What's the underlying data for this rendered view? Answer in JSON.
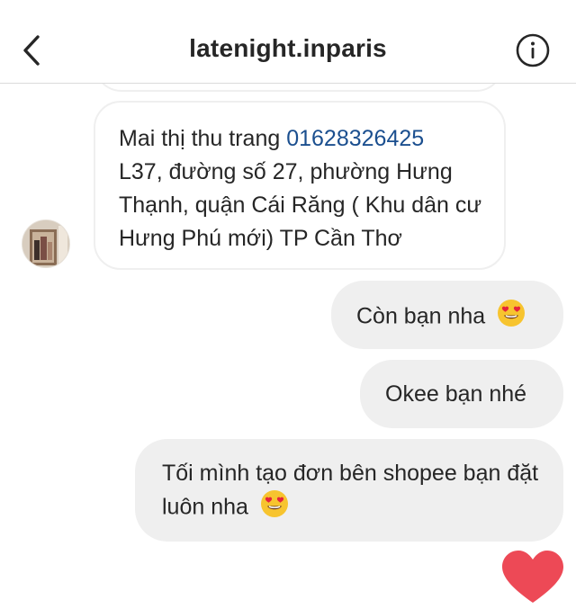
{
  "header": {
    "title": "latenight.inparis",
    "back_icon": "chevron-left-icon",
    "info_icon": "info-circle-icon"
  },
  "messages": [
    {
      "direction": "incoming",
      "name": "Mai thị thu trang",
      "phone": "01628326425",
      "address": "L37, đường số 27, phường Hưng Thạnh, quận Cái Răng ( Khu dân cư Hưng Phú mới) TP Cần Thơ"
    },
    {
      "direction": "outgoing",
      "text": "Còn bạn nha",
      "emoji": "heart-eyes-emoji"
    },
    {
      "direction": "outgoing",
      "text": "Okee bạn nhé"
    },
    {
      "direction": "outgoing",
      "text": "Tối mình tạo đơn bên shopee bạn đặt luôn nha",
      "emoji": "heart-eyes-emoji"
    }
  ],
  "reaction_icon": "heart-icon",
  "colors": {
    "incoming_border": "#efefef",
    "outgoing_bg": "#efefef",
    "link": "#1b4f8f",
    "heart": "#ed4956",
    "text": "#262626"
  }
}
